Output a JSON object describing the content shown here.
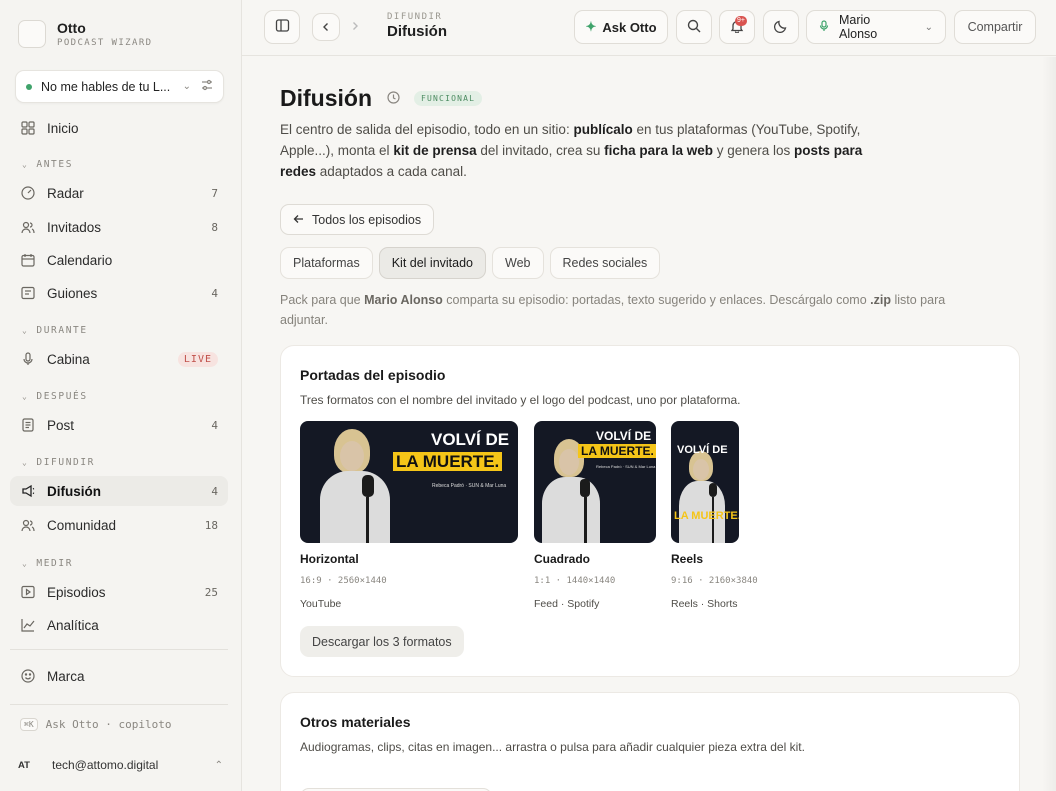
{
  "brand": {
    "name": "Otto",
    "subtitle": "PODCAST WIZARD"
  },
  "workspace": {
    "label": "No me hables de tu L...",
    "status_color": "#3fa36b"
  },
  "sidebar": {
    "home": {
      "label": "Inicio",
      "icon": "grid-icon"
    },
    "sections": [
      {
        "label": "ANTES"
      },
      {
        "label": "DURANTE"
      },
      {
        "label": "DESPUÉS"
      },
      {
        "label": "DIFUNDIR"
      },
      {
        "label": "MEDIR"
      }
    ],
    "items": [
      {
        "label": "Radar",
        "count": "7",
        "icon": "gauge-icon"
      },
      {
        "label": "Invitados",
        "count": "8",
        "icon": "users-icon"
      },
      {
        "label": "Calendario",
        "count": "",
        "icon": "calendar-icon"
      },
      {
        "label": "Guiones",
        "count": "4",
        "icon": "script-icon"
      },
      {
        "label": "Cabina",
        "count": "LIVE",
        "icon": "mic-icon"
      },
      {
        "label": "Post",
        "count": "4",
        "icon": "document-icon"
      },
      {
        "label": "Difusión",
        "count": "4",
        "icon": "megaphone-icon",
        "active": true
      },
      {
        "label": "Comunidad",
        "count": "18",
        "icon": "community-icon"
      },
      {
        "label": "Episodios",
        "count": "25",
        "icon": "play-icon"
      },
      {
        "label": "Analítica",
        "count": "",
        "icon": "chart-icon"
      },
      {
        "label": "Marca",
        "count": "",
        "icon": "palette-icon"
      }
    ],
    "ask_shortcut": "⌘K",
    "ask_label": "Ask Otto · copiloto",
    "account": {
      "initials": "AT",
      "email": "tech@attomo.digital"
    }
  },
  "topbar": {
    "crumb_small": "DIFUNDIR",
    "crumb_title": "Difusión",
    "ask_label": "Ask Otto",
    "notif_badge": "9+",
    "user_name": "Mario Alonso",
    "share_label": "Compartir"
  },
  "page": {
    "title": "Difusión",
    "tag": "FUNCIONAL",
    "desc": {
      "p1": "El centro de salida del episodio, todo en un sitio: ",
      "b1": "publícalo",
      "p2": " en tus plataformas (YouTube, Spotify, Apple...), monta el ",
      "b2": "kit de prensa",
      "p3": " del invitado, crea su ",
      "b3": "ficha para la web",
      "p4": " y genera los ",
      "b4": "posts para redes",
      "p5": " adaptados a cada canal."
    },
    "back_label": "Todos los episodios",
    "tabs": [
      {
        "label": "Plataformas"
      },
      {
        "label": "Kit del invitado",
        "active": true
      },
      {
        "label": "Web"
      },
      {
        "label": "Redes sociales"
      }
    ],
    "hint": {
      "p1": "Pack para que ",
      "b1": "Mario Alonso",
      "p2": " comparta su episodio: portadas, texto sugerido y enlaces. Descárgalo como ",
      "b2": ".zip",
      "p3": " listo para adjuntar."
    }
  },
  "covers_card": {
    "title": "Portadas del episodio",
    "subtitle": "Tres formatos con el nombre del invitado y el logo del podcast, uno por plataforma.",
    "thumb_text": {
      "line1": "VOLVÍ DE",
      "line2": "LA MUERTE."
    },
    "formats": [
      {
        "name": "Horizontal",
        "spec": "16:9 · 2560×1440",
        "platforms": "YouTube"
      },
      {
        "name": "Cuadrado",
        "spec": "1:1 · 1440×1440",
        "platforms": "Feed · Spotify"
      },
      {
        "name": "Reels",
        "spec": "9:16 · 2160×3840",
        "platforms": "Reels · Shorts"
      }
    ],
    "download_label": "Descargar los 3 formatos"
  },
  "other_card": {
    "title": "Otros materiales",
    "subtitle": "Audiogramas, clips, citas en imagen... arrastra o pulsa para añadir cualquier pieza extra del kit."
  }
}
